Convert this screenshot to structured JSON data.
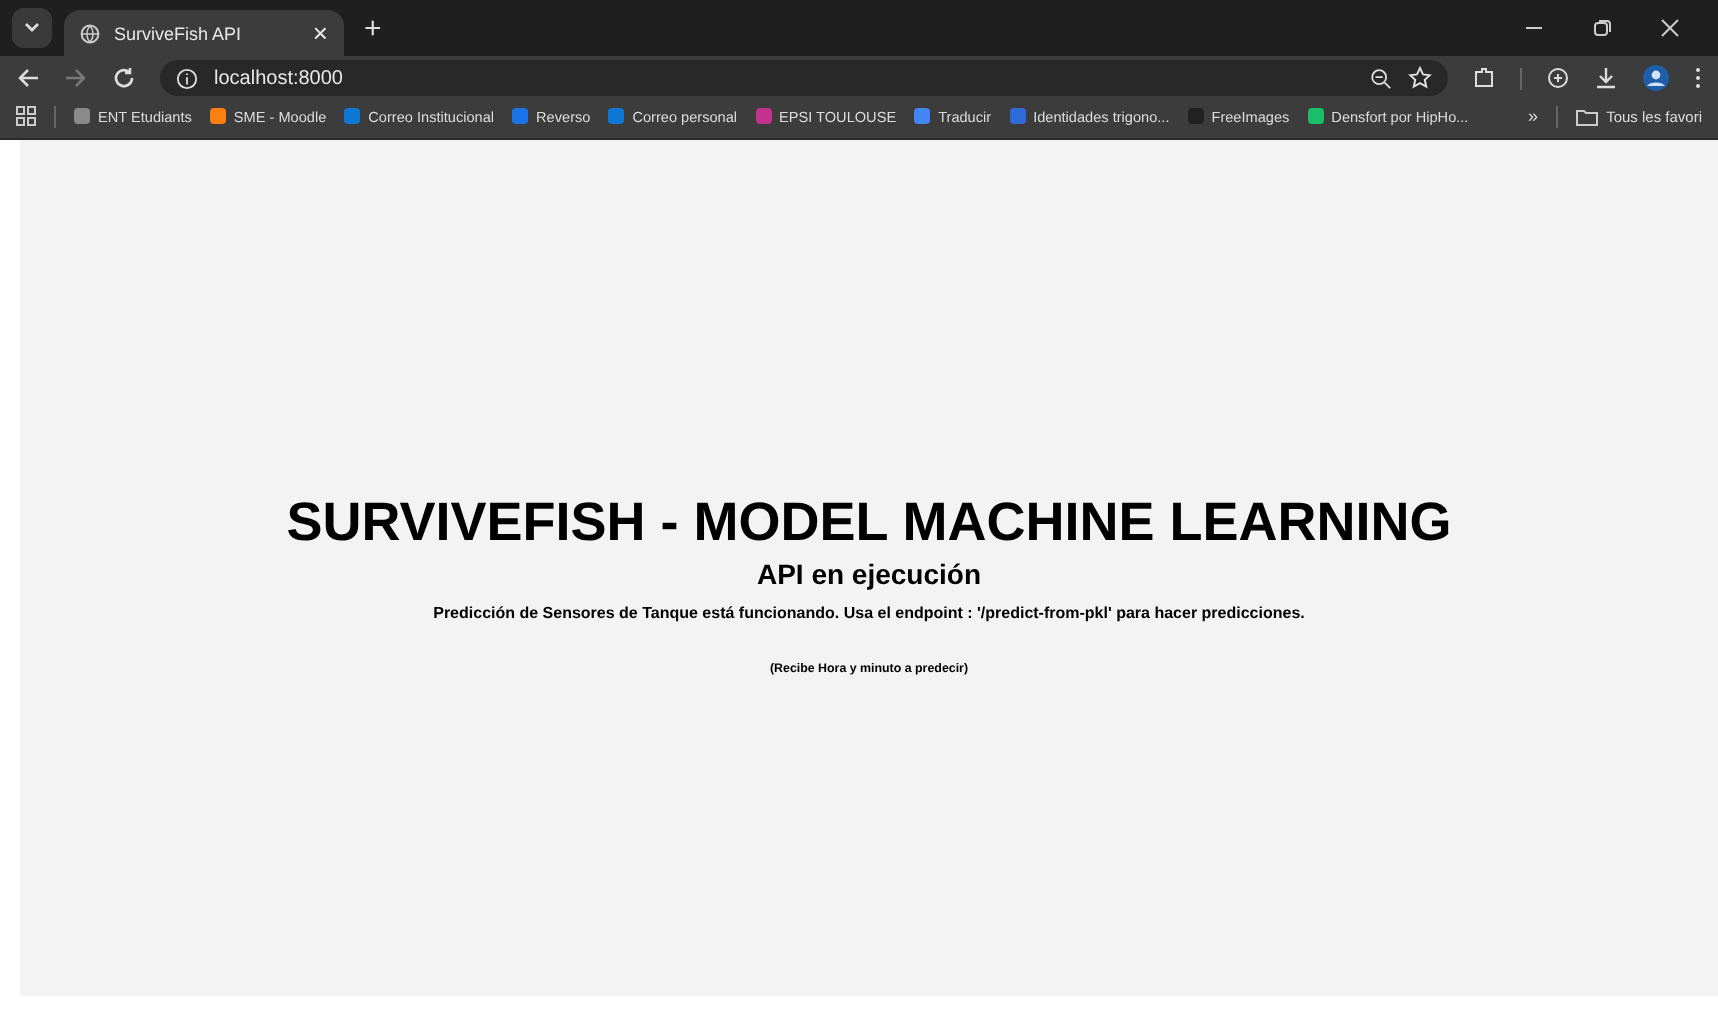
{
  "tabs": [
    {
      "title": "SurviveFish API",
      "close": "×",
      "selected": true
    }
  ],
  "new_tab": "+",
  "address_bar": {
    "url": "localhost:8000"
  },
  "bookmarks": [
    {
      "label": "ENT Etudiants",
      "color": "#8a8a8a"
    },
    {
      "label": "SME - Moodle",
      "color": "#f98012"
    },
    {
      "label": "Correo Institucional",
      "color": "#0f78d4"
    },
    {
      "label": "Reverso",
      "color": "#1a73e8"
    },
    {
      "label": "Correo personal",
      "color": "#0f78d4"
    },
    {
      "label": "EPSI TOULOUSE",
      "color": "#c2338d"
    },
    {
      "label": "Traducir",
      "color": "#4285f4"
    },
    {
      "label": "Identidades trigono...",
      "color": "#2f6bd8"
    },
    {
      "label": "FreeImages",
      "color": "#222222"
    },
    {
      "label": "Densfort por HipHo...",
      "color": "#1bbf6b"
    }
  ],
  "bookmarks_more": "»",
  "all_bookmarks": "Tous les favori",
  "page": {
    "title": "SURVIVEFISH - MODEL MACHINE LEARNING",
    "subtitle": "API en ejecución",
    "description": "Predicción de Sensores de Tanque está funcionando. Usa el endpoint : '/predict-from-pkl' para hacer predicciones.",
    "note": "(Recibe Hora y minuto a predecir)"
  }
}
